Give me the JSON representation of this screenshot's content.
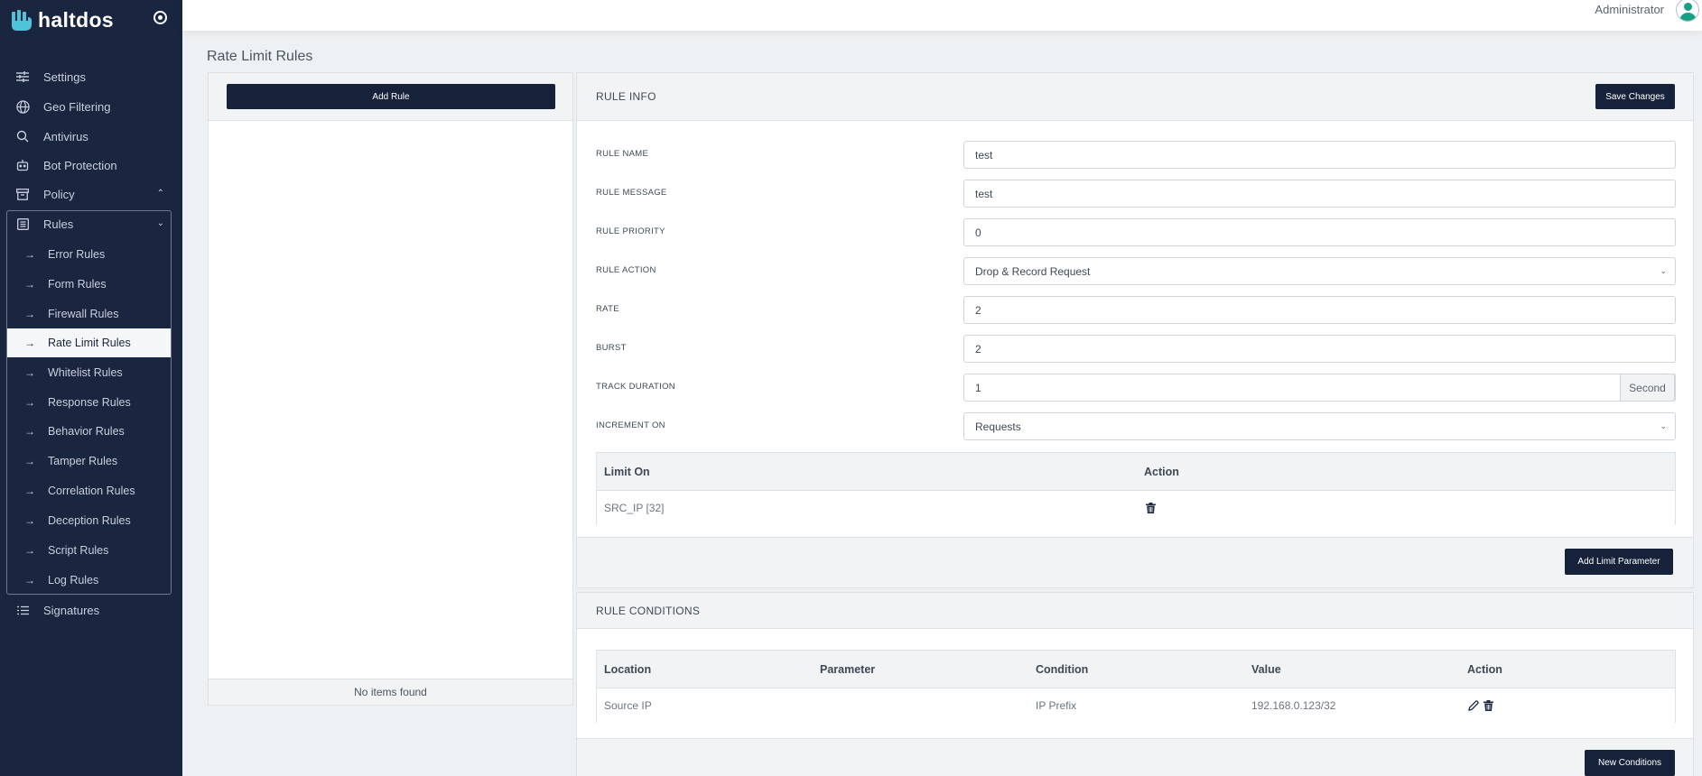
{
  "app": {
    "logo_text": "haltdos"
  },
  "topbar": {
    "user_name": "Administrator"
  },
  "sidebar": {
    "items": [
      {
        "label": "Settings"
      },
      {
        "label": "Geo Filtering"
      },
      {
        "label": "Antivirus"
      },
      {
        "label": "Bot Protection"
      },
      {
        "label": "Policy"
      },
      {
        "label": "Rules"
      },
      {
        "label": "Signatures"
      }
    ],
    "rules_sub": [
      {
        "label": "Error Rules"
      },
      {
        "label": "Form Rules"
      },
      {
        "label": "Firewall Rules"
      },
      {
        "label": "Rate Limit Rules"
      },
      {
        "label": "Whitelist Rules"
      },
      {
        "label": "Response Rules"
      },
      {
        "label": "Behavior Rules"
      },
      {
        "label": "Tamper Rules"
      },
      {
        "label": "Correlation Rules"
      },
      {
        "label": "Deception Rules"
      },
      {
        "label": "Script Rules"
      },
      {
        "label": "Log Rules"
      }
    ],
    "active_sub": "Rate Limit Rules"
  },
  "page": {
    "title": "Rate Limit Rules"
  },
  "list_panel": {
    "add_button": "Add Rule",
    "empty_text": "No items found"
  },
  "rule_info": {
    "title": "RULE INFO",
    "save_button": "Save Changes",
    "fields": {
      "rule_name": {
        "label": "RULE NAME",
        "value": "test"
      },
      "rule_message": {
        "label": "RULE MESSAGE",
        "value": "test"
      },
      "rule_priority": {
        "label": "RULE PRIORITY",
        "value": "0"
      },
      "rule_action": {
        "label": "RULE ACTION",
        "value": "Drop & Record Request"
      },
      "rate": {
        "label": "RATE",
        "value": "2"
      },
      "burst": {
        "label": "BURST",
        "value": "2"
      },
      "track_duration": {
        "label": "TRACK DURATION",
        "value": "1",
        "suffix": "Second"
      },
      "increment_on": {
        "label": "INCREMENT ON",
        "value": "Requests"
      }
    },
    "limit_table": {
      "headers": [
        "Limit On",
        "Action"
      ],
      "rows": [
        {
          "limit_on": "SRC_IP [32]"
        }
      ]
    },
    "add_limit_button": "Add Limit Parameter"
  },
  "rule_conditions": {
    "title": "RULE CONDITIONS",
    "headers": [
      "Location",
      "Parameter",
      "Condition",
      "Value",
      "Action"
    ],
    "rows": [
      {
        "location": "Source IP",
        "parameter": "",
        "condition": "IP Prefix",
        "value": "192.168.0.123/32"
      }
    ],
    "new_button": "New Conditions"
  },
  "colors": {
    "sidebar_bg": "#1a2540",
    "button_dark": "#16213a",
    "avatar_accent": "#16a085"
  }
}
